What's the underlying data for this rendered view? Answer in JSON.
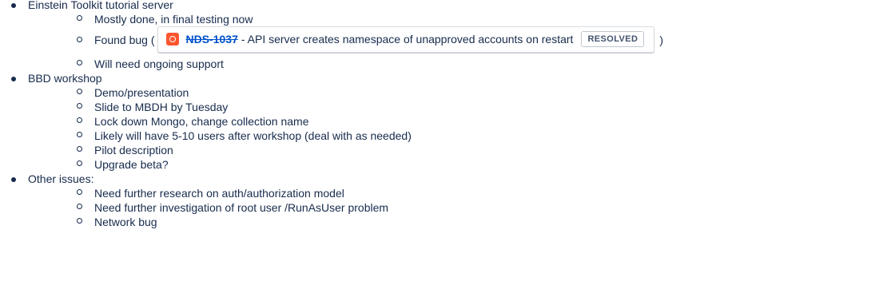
{
  "items": [
    {
      "text": "Einstein Toolkit tutorial server",
      "children": [
        {
          "text": "Mostly done, in final testing now"
        },
        {
          "text_before": "Found bug (",
          "issue": {
            "key": "NDS-1037",
            "summary": "- API server creates namespace of unapproved accounts on restart",
            "status": "RESOLVED",
            "icon": "bug-icon",
            "icon_color": "#ff5630",
            "key_color": "#0052cc"
          },
          "text_after": ")"
        },
        {
          "text": "Will need ongoing support"
        }
      ]
    },
    {
      "text": "BBD workshop",
      "children": [
        {
          "text": "Demo/presentation"
        },
        {
          "text": "Slide to MBDH by Tuesday"
        },
        {
          "text": "Lock down Mongo, change collection name"
        },
        {
          "text": "Likely will have 5-10 users after workshop (deal with as needed)"
        },
        {
          "text": "Pilot description"
        },
        {
          "text": "Upgrade beta?"
        }
      ]
    },
    {
      "text": "Other issues:",
      "children": [
        {
          "text": "Need further research on auth/authorization model"
        },
        {
          "text": "Need further investigation of root user /RunAsUser problem"
        },
        {
          "text": "Network bug"
        }
      ]
    }
  ]
}
